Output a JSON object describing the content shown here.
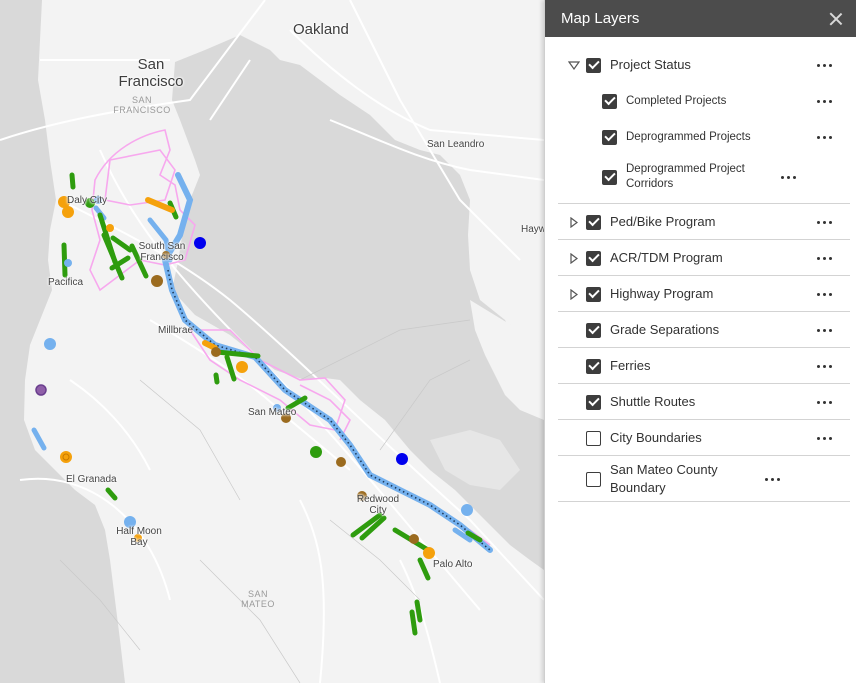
{
  "panel": {
    "title": "Map Layers",
    "close_icon": "close-icon",
    "layers": [
      {
        "label": "Project Status",
        "checked": true,
        "expanded": true,
        "sublayers": [
          {
            "label": "Completed Projects",
            "checked": true
          },
          {
            "label": "Deprogrammed Projects",
            "checked": true
          },
          {
            "label": "Deprogrammed Project Corridors",
            "checked": true
          }
        ]
      },
      {
        "label": "Ped/Bike Program",
        "checked": true,
        "expandable": true
      },
      {
        "label": "ACR/TDM Program",
        "checked": true,
        "expandable": true
      },
      {
        "label": "Highway Program",
        "checked": true,
        "expandable": true
      },
      {
        "label": "Grade Separations",
        "checked": true
      },
      {
        "label": "Ferries",
        "checked": true
      },
      {
        "label": "Shuttle Routes",
        "checked": true
      },
      {
        "label": "City Boundaries",
        "checked": false
      },
      {
        "label": "San Mateo County Boundary",
        "checked": false
      }
    ]
  },
  "map": {
    "labels": {
      "oakland": "Oakland",
      "san_francisco": "San Francisco",
      "san_francisco_region": "SAN FRANCISCO",
      "san_leandro": "San Leandro",
      "hayward": "Hayw",
      "daly_city": "Daly City",
      "south_san_francisco": "South San Francisco",
      "pacifica": "Pacifica",
      "millbrae": "Millbrae",
      "san_mateo": "San Mateo",
      "redwood_city": "Redwood City",
      "el_granada": "El Granada",
      "half_moon_bay": "Half Moon Bay",
      "palo_alto": "Palo Alto",
      "san_mateo_region": "SAN MATEO"
    },
    "colors": {
      "water": "#d9d9d9",
      "land": "#f2f2f2",
      "road": "#ffffff",
      "completed": "#2e9c0e",
      "deprogrammed": "#f5a10c",
      "corridor_pink": "#f7a8ee",
      "transit_blue": "#75b1ee",
      "grade_sep": "#9b6b1f",
      "ferry": "#0000ee"
    }
  }
}
